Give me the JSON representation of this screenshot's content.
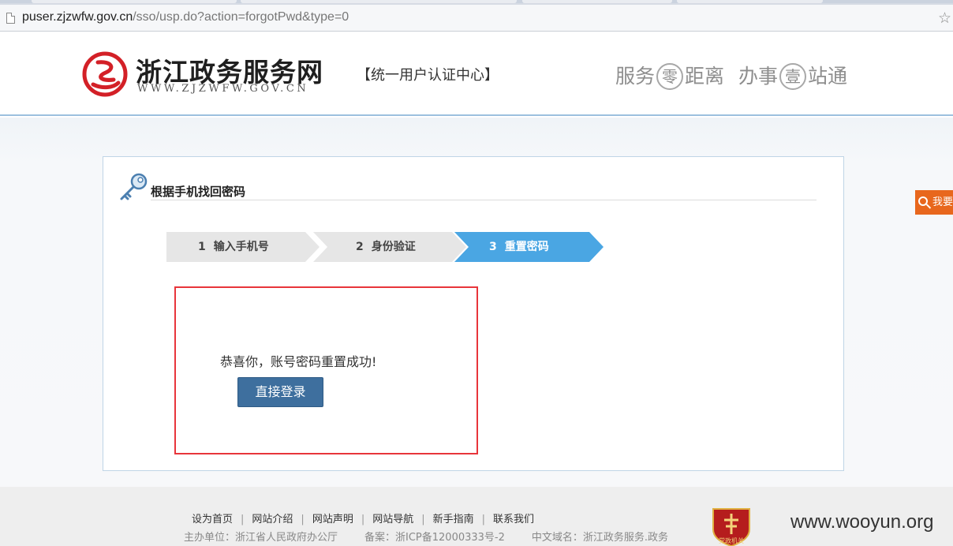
{
  "browser": {
    "url_host": "puser.zjzwfw.gov.cn",
    "url_path": "/sso/usp.do?action=forgotPwd&type=0"
  },
  "header": {
    "site_name": "浙江政务服务网",
    "site_domain": "WWW.ZJZWFW.GOV.CN",
    "center_name": "【统一用户认证中心】",
    "slogan_1a": "服务",
    "slogan_1b": "零",
    "slogan_1c": "距离",
    "slogan_2a": "办事",
    "slogan_2b": "壹",
    "slogan_2c": "站通",
    "brand_color": "#d32027"
  },
  "panel": {
    "title": "根据手机找回密码",
    "steps": [
      {
        "num": "1",
        "label": "输入手机号",
        "state": "done"
      },
      {
        "num": "2",
        "label": "身份验证",
        "state": "done"
      },
      {
        "num": "3",
        "label": "重置密码",
        "state": "active"
      }
    ],
    "active_step_color": "#4aa6e3",
    "success_message": "恭喜你，账号密码重置成功!",
    "login_button": "直接登录",
    "highlight_color": "#e8353b"
  },
  "side_tab": {
    "label": "我要",
    "color": "#e8671d"
  },
  "footer": {
    "links": [
      "设为首页",
      "网站介绍",
      "网站声明",
      "网站导航",
      "新手指南",
      "联系我们"
    ],
    "organizer": "主办单位：浙江省人民政府办公厅",
    "icp": "备案：浙ICP备12000333号-2",
    "cn_domain": "中文域名：浙江政务服务.政务",
    "badge_text": "党政机关",
    "watermark": "www.wooyun.org"
  }
}
